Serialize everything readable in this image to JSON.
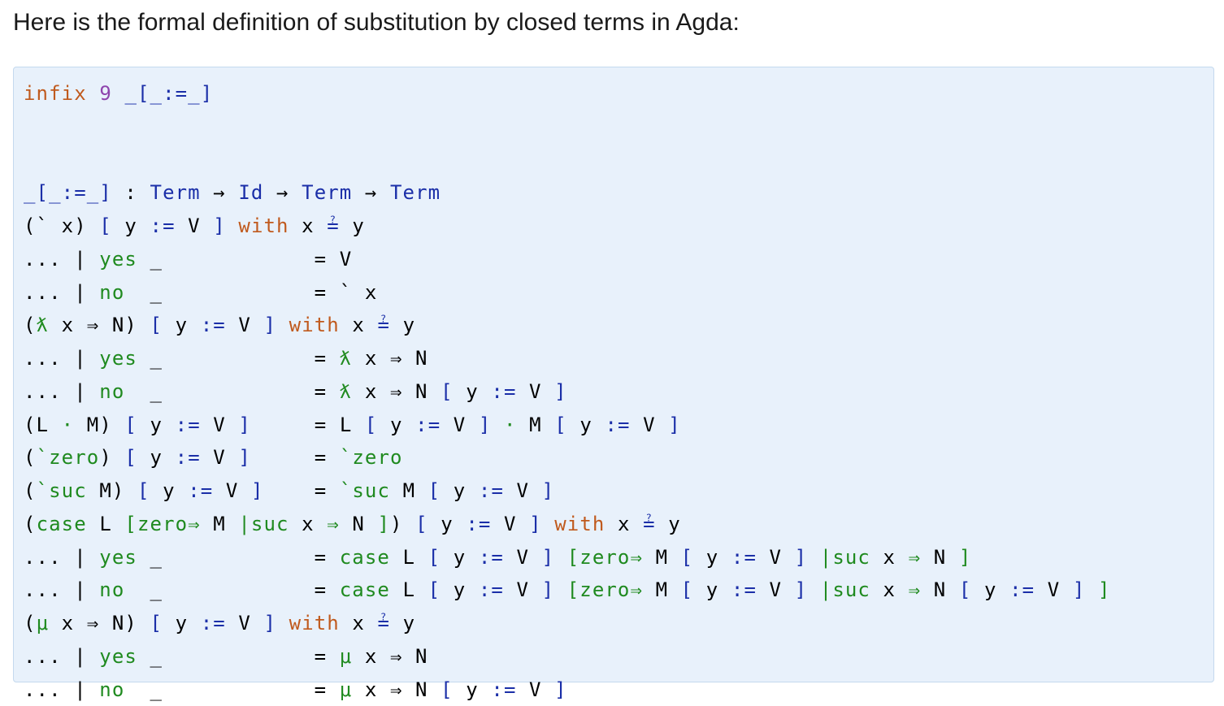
{
  "intro": "Here is the formal definition of substitution by closed terms in Agda:",
  "code": {
    "lines": [
      [
        {
          "t": "infix",
          "c": "kw"
        },
        {
          "t": " "
        },
        {
          "t": "9",
          "c": "num"
        },
        {
          "t": " "
        },
        {
          "t": "_[_:=_]",
          "c": "fn"
        }
      ],
      [],
      [],
      [
        {
          "t": "_[_:=_]",
          "c": "fn"
        },
        {
          "t": " : "
        },
        {
          "t": "Term",
          "c": "fn"
        },
        {
          "t": " → "
        },
        {
          "t": "Id",
          "c": "fn"
        },
        {
          "t": " → "
        },
        {
          "t": "Term",
          "c": "fn"
        },
        {
          "t": " → "
        },
        {
          "t": "Term",
          "c": "fn"
        }
      ],
      [
        {
          "t": "(` x) "
        },
        {
          "t": "[",
          "c": "fn"
        },
        {
          "t": " y "
        },
        {
          "t": ":=",
          "c": "fn"
        },
        {
          "t": " V "
        },
        {
          "t": "]",
          "c": "fn"
        },
        {
          "t": " "
        },
        {
          "t": "with",
          "c": "kw"
        },
        {
          "t": " x "
        },
        {
          "t": "≟",
          "c": "fn"
        },
        {
          "t": " y"
        }
      ],
      [
        {
          "t": "... | "
        },
        {
          "t": "yes",
          "c": "con"
        },
        {
          "t": " _            = V"
        }
      ],
      [
        {
          "t": "... | "
        },
        {
          "t": "no",
          "c": "con"
        },
        {
          "t": "  _            = ` x"
        }
      ],
      [
        {
          "t": "("
        },
        {
          "t": "ƛ",
          "c": "con"
        },
        {
          "t": " x ⇒ N) "
        },
        {
          "t": "[",
          "c": "fn"
        },
        {
          "t": " y "
        },
        {
          "t": ":=",
          "c": "fn"
        },
        {
          "t": " V "
        },
        {
          "t": "]",
          "c": "fn"
        },
        {
          "t": " "
        },
        {
          "t": "with",
          "c": "kw"
        },
        {
          "t": " x "
        },
        {
          "t": "≟",
          "c": "fn"
        },
        {
          "t": " y"
        }
      ],
      [
        {
          "t": "... | "
        },
        {
          "t": "yes",
          "c": "con"
        },
        {
          "t": " _            = "
        },
        {
          "t": "ƛ",
          "c": "con"
        },
        {
          "t": " x ⇒ N"
        }
      ],
      [
        {
          "t": "... | "
        },
        {
          "t": "no",
          "c": "con"
        },
        {
          "t": "  _            = "
        },
        {
          "t": "ƛ",
          "c": "con"
        },
        {
          "t": " x ⇒ N "
        },
        {
          "t": "[",
          "c": "fn"
        },
        {
          "t": " y "
        },
        {
          "t": ":=",
          "c": "fn"
        },
        {
          "t": " V "
        },
        {
          "t": "]",
          "c": "fn"
        }
      ],
      [
        {
          "t": "(L "
        },
        {
          "t": "·",
          "c": "con"
        },
        {
          "t": " M) "
        },
        {
          "t": "[",
          "c": "fn"
        },
        {
          "t": " y "
        },
        {
          "t": ":=",
          "c": "fn"
        },
        {
          "t": " V "
        },
        {
          "t": "]",
          "c": "fn"
        },
        {
          "t": "     = L "
        },
        {
          "t": "[",
          "c": "fn"
        },
        {
          "t": " y "
        },
        {
          "t": ":=",
          "c": "fn"
        },
        {
          "t": " V "
        },
        {
          "t": "]",
          "c": "fn"
        },
        {
          "t": " "
        },
        {
          "t": "·",
          "c": "con"
        },
        {
          "t": " M "
        },
        {
          "t": "[",
          "c": "fn"
        },
        {
          "t": " y "
        },
        {
          "t": ":=",
          "c": "fn"
        },
        {
          "t": " V "
        },
        {
          "t": "]",
          "c": "fn"
        }
      ],
      [
        {
          "t": "("
        },
        {
          "t": "`zero",
          "c": "con"
        },
        {
          "t": ") "
        },
        {
          "t": "[",
          "c": "fn"
        },
        {
          "t": " y "
        },
        {
          "t": ":=",
          "c": "fn"
        },
        {
          "t": " V "
        },
        {
          "t": "]",
          "c": "fn"
        },
        {
          "t": "     = "
        },
        {
          "t": "`zero",
          "c": "con"
        }
      ],
      [
        {
          "t": "("
        },
        {
          "t": "`suc",
          "c": "con"
        },
        {
          "t": " M) "
        },
        {
          "t": "[",
          "c": "fn"
        },
        {
          "t": " y "
        },
        {
          "t": ":=",
          "c": "fn"
        },
        {
          "t": " V "
        },
        {
          "t": "]",
          "c": "fn"
        },
        {
          "t": "    = "
        },
        {
          "t": "`suc",
          "c": "con"
        },
        {
          "t": " M "
        },
        {
          "t": "[",
          "c": "fn"
        },
        {
          "t": " y "
        },
        {
          "t": ":=",
          "c": "fn"
        },
        {
          "t": " V "
        },
        {
          "t": "]",
          "c": "fn"
        }
      ],
      [
        {
          "t": "("
        },
        {
          "t": "case",
          "c": "con"
        },
        {
          "t": " L "
        },
        {
          "t": "[zero⇒",
          "c": "con"
        },
        {
          "t": " M "
        },
        {
          "t": "|suc",
          "c": "con"
        },
        {
          "t": " x "
        },
        {
          "t": "⇒",
          "c": "con"
        },
        {
          "t": " N "
        },
        {
          "t": "]",
          "c": "con"
        },
        {
          "t": ") "
        },
        {
          "t": "[",
          "c": "fn"
        },
        {
          "t": " y "
        },
        {
          "t": ":=",
          "c": "fn"
        },
        {
          "t": " V "
        },
        {
          "t": "]",
          "c": "fn"
        },
        {
          "t": " "
        },
        {
          "t": "with",
          "c": "kw"
        },
        {
          "t": " x "
        },
        {
          "t": "≟",
          "c": "fn"
        },
        {
          "t": " y"
        }
      ],
      [
        {
          "t": "... | "
        },
        {
          "t": "yes",
          "c": "con"
        },
        {
          "t": " _            = "
        },
        {
          "t": "case",
          "c": "con"
        },
        {
          "t": " L "
        },
        {
          "t": "[",
          "c": "fn"
        },
        {
          "t": " y "
        },
        {
          "t": ":=",
          "c": "fn"
        },
        {
          "t": " V "
        },
        {
          "t": "]",
          "c": "fn"
        },
        {
          "t": " "
        },
        {
          "t": "[zero⇒",
          "c": "con"
        },
        {
          "t": " M "
        },
        {
          "t": "[",
          "c": "fn"
        },
        {
          "t": " y "
        },
        {
          "t": ":=",
          "c": "fn"
        },
        {
          "t": " V "
        },
        {
          "t": "]",
          "c": "fn"
        },
        {
          "t": " "
        },
        {
          "t": "|suc",
          "c": "con"
        },
        {
          "t": " x "
        },
        {
          "t": "⇒",
          "c": "con"
        },
        {
          "t": " N "
        },
        {
          "t": "]",
          "c": "con"
        }
      ],
      [
        {
          "t": "... | "
        },
        {
          "t": "no",
          "c": "con"
        },
        {
          "t": "  _            = "
        },
        {
          "t": "case",
          "c": "con"
        },
        {
          "t": " L "
        },
        {
          "t": "[",
          "c": "fn"
        },
        {
          "t": " y "
        },
        {
          "t": ":=",
          "c": "fn"
        },
        {
          "t": " V "
        },
        {
          "t": "]",
          "c": "fn"
        },
        {
          "t": " "
        },
        {
          "t": "[zero⇒",
          "c": "con"
        },
        {
          "t": " M "
        },
        {
          "t": "[",
          "c": "fn"
        },
        {
          "t": " y "
        },
        {
          "t": ":=",
          "c": "fn"
        },
        {
          "t": " V "
        },
        {
          "t": "]",
          "c": "fn"
        },
        {
          "t": " "
        },
        {
          "t": "|suc",
          "c": "con"
        },
        {
          "t": " x "
        },
        {
          "t": "⇒",
          "c": "con"
        },
        {
          "t": " N "
        },
        {
          "t": "[",
          "c": "fn"
        },
        {
          "t": " y "
        },
        {
          "t": ":=",
          "c": "fn"
        },
        {
          "t": " V "
        },
        {
          "t": "]",
          "c": "fn"
        },
        {
          "t": " "
        },
        {
          "t": "]",
          "c": "con"
        }
      ],
      [
        {
          "t": "("
        },
        {
          "t": "μ",
          "c": "con"
        },
        {
          "t": " x ⇒ N) "
        },
        {
          "t": "[",
          "c": "fn"
        },
        {
          "t": " y "
        },
        {
          "t": ":=",
          "c": "fn"
        },
        {
          "t": " V "
        },
        {
          "t": "]",
          "c": "fn"
        },
        {
          "t": " "
        },
        {
          "t": "with",
          "c": "kw"
        },
        {
          "t": " x "
        },
        {
          "t": "≟",
          "c": "fn"
        },
        {
          "t": " y"
        }
      ],
      [
        {
          "t": "... | "
        },
        {
          "t": "yes",
          "c": "con"
        },
        {
          "t": " _            = "
        },
        {
          "t": "μ",
          "c": "con"
        },
        {
          "t": " x ⇒ N"
        }
      ],
      [
        {
          "t": "... | "
        },
        {
          "t": "no",
          "c": "con"
        },
        {
          "t": "  _            = "
        },
        {
          "t": "μ",
          "c": "con"
        },
        {
          "t": " x ⇒ N "
        },
        {
          "t": "[",
          "c": "fn"
        },
        {
          "t": " y "
        },
        {
          "t": ":=",
          "c": "fn"
        },
        {
          "t": " V "
        },
        {
          "t": "]",
          "c": "fn"
        }
      ]
    ]
  }
}
